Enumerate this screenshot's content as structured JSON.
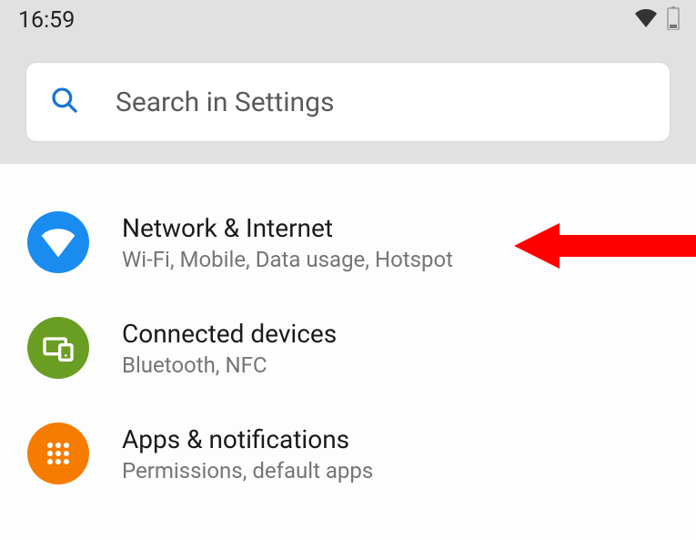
{
  "statusBar": {
    "time": "16:59"
  },
  "search": {
    "placeholder": "Search in Settings"
  },
  "colors": {
    "network_icon_bg": "#1a8cf0",
    "connected_icon_bg": "#6a9e23",
    "apps_icon_bg": "#f57c00",
    "arrow": "#ff0000"
  },
  "items": [
    {
      "icon": "wifi-icon",
      "title": "Network & Internet",
      "subtitle": "Wi-Fi, Mobile, Data usage, Hotspot"
    },
    {
      "icon": "devices-icon",
      "title": "Connected devices",
      "subtitle": "Bluetooth, NFC"
    },
    {
      "icon": "apps-grid-icon",
      "title": "Apps & notifications",
      "subtitle": "Permissions, default apps"
    }
  ]
}
